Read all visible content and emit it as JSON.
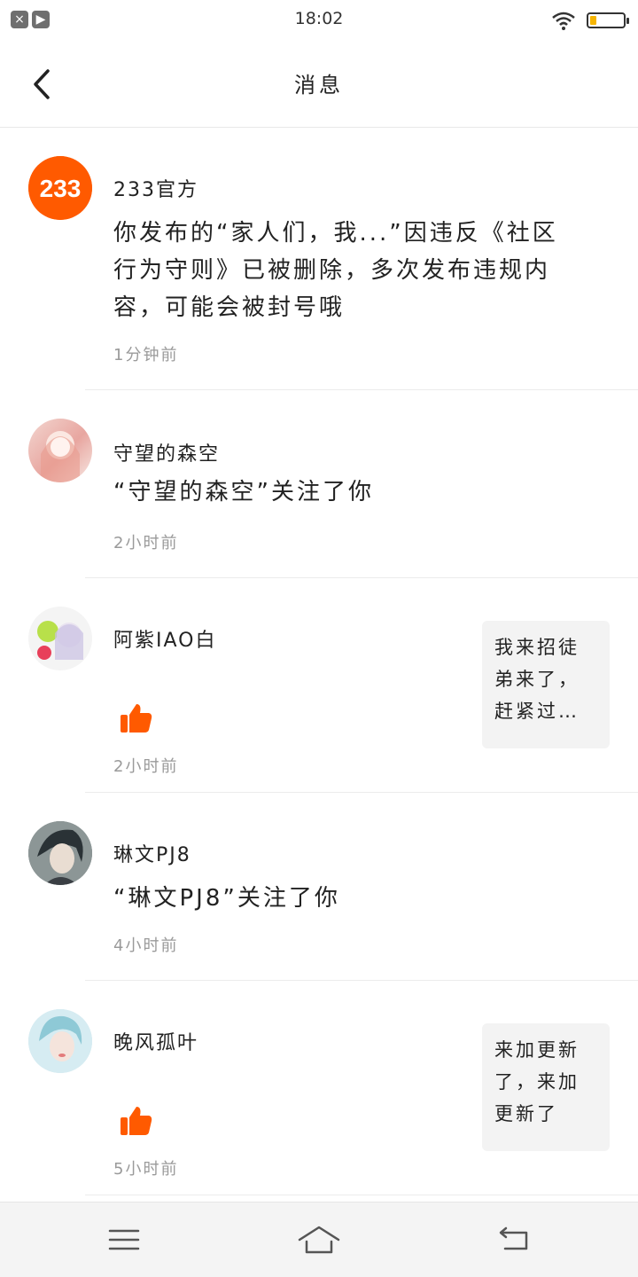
{
  "status_bar": {
    "time": "18:02",
    "battery_level": 0.2
  },
  "header": {
    "title": "消息"
  },
  "messages": [
    {
      "name": "233官方",
      "text": "你发布的“家人们，我...”因违反《社区行为守则》已被删除，多次发布违规内容，可能会被封号哦",
      "time": "1分钟前"
    },
    {
      "name": "守望的森空",
      "text": "“守望的森空”关注了你",
      "time": "2小时前"
    },
    {
      "name": "阿紫IAO白",
      "time": "2小时前",
      "quote": "我来招徒弟来了，赶紧过…"
    },
    {
      "name": "琳文PJ8",
      "text": "“琳文PJ8”关注了你",
      "time": "4小时前"
    },
    {
      "name": "晚风孤叶",
      "time": "5小时前",
      "quote": "来加更新了，来加更新了"
    }
  ],
  "colors": {
    "accent": "#ff5a00"
  }
}
